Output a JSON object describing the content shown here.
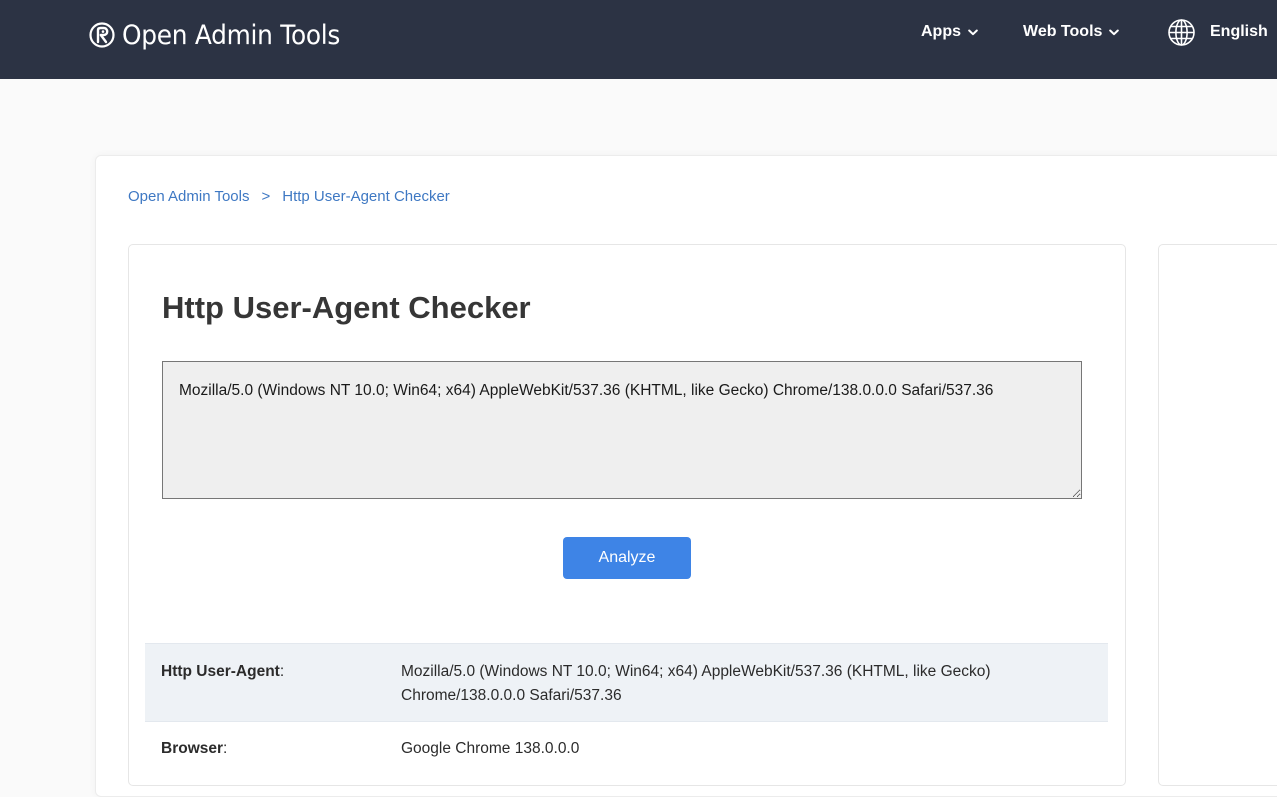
{
  "header": {
    "brand": "Open Admin Tools",
    "nav": {
      "apps": "Apps",
      "web_tools": "Web Tools",
      "language": "English"
    }
  },
  "breadcrumb": {
    "home": "Open Admin Tools",
    "separator": ">",
    "current": "Http User-Agent Checker"
  },
  "tool": {
    "title": "Http User-Agent Checker",
    "input_value": "Mozilla/5.0 (Windows NT 10.0; Win64; x64) AppleWebKit/537.36 (KHTML, like Gecko) Chrome/138.0.0.0 Safari/537.36",
    "analyze_label": "Analyze"
  },
  "results": {
    "user_agent": {
      "label": "Http User-Agent",
      "colon": ":",
      "value": "Mozilla/5.0 (Windows NT 10.0; Win64; x64) AppleWebKit/537.36 (KHTML, like Gecko) Chrome/138.0.0.0 Safari/537.36"
    },
    "browser": {
      "label": "Browser",
      "colon": ":",
      "value": "Google Chrome 138.0.0.0"
    }
  },
  "icons": {
    "logo": "open-admin-tools-logo-icon",
    "apps_chevron": "chevron-down-icon",
    "web_tools_chevron": "chevron-down-icon",
    "language": "globe-icon"
  },
  "colors": {
    "navbar_bg": "#2c3344",
    "link": "#3e78c3",
    "button_bg": "#3e84e6",
    "ua_row_bg": "#eef2f6",
    "textarea_bg": "#efefef"
  }
}
